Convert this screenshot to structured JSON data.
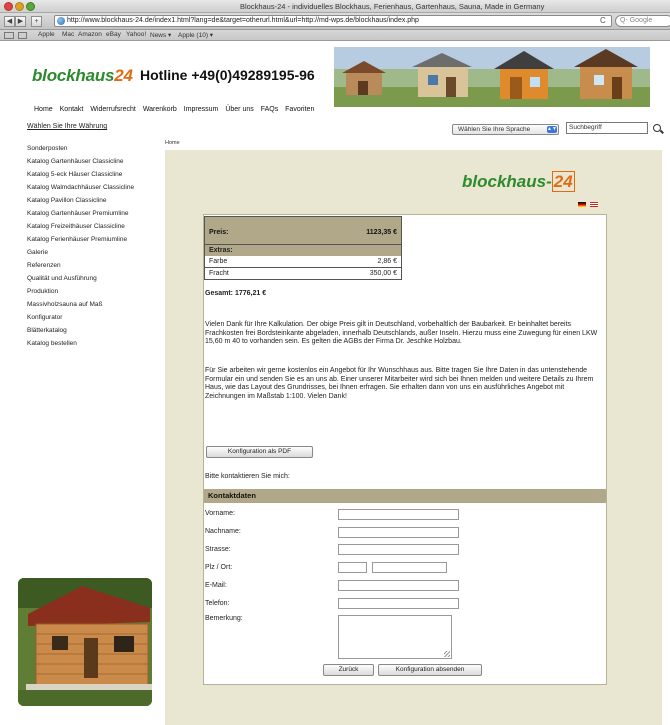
{
  "window": {
    "title": "Blockhaus-24 - individuelles Blockhaus, Ferienhaus, Gartenhaus, Sauna, Made in Germany"
  },
  "browser": {
    "back": "◀",
    "forward": "▶",
    "add": "+",
    "url": "http://www.blockhaus-24.de/index1.html?lang=de&target=otherurl.html&url=http://md-wps.de/blockhaus/index.php",
    "reload": "C",
    "search_placeholder": "Q- Google",
    "bookmarks": [
      "Apple",
      "Mac",
      "Amazon",
      "eBay",
      "Yahoo!",
      "News ▾",
      "Apple (10) ▾"
    ]
  },
  "header": {
    "logo_text": "blockhaus",
    "logo_num": "24",
    "hotline": "Hotline +49(0)49289195-96",
    "nav": [
      "Home",
      "Kontakt",
      "Widerrufsrecht",
      "Warenkorb",
      "Impressum",
      "Über uns",
      "FAQs",
      "Favoriten"
    ]
  },
  "sidebar": {
    "currency_link": "Wählen Sie Ihre Währung",
    "items": [
      "Sonderposten",
      "Katalog Gartenhäuser Classicline",
      "Katalog 5-eck Häuser Classicline",
      "Katalog Walmdachhäuser Classicline",
      "Katalog Pavillon Classicline",
      "Katalog Gartenhäuser Premiumline",
      "Katalog Freizeithäuser Classicline",
      "Katalog Ferienhäuser Premiumline",
      "Galerie",
      "Referenzen",
      "Qualität und Ausführung",
      "Produktion",
      "Massivholzsauna auf Maß",
      "Konfigurator",
      "Blätterkatalog",
      "Katalog bestellen"
    ]
  },
  "language": {
    "selected": "Wählen Sie Ihre Sprache"
  },
  "search": {
    "placeholder": "Suchbegriff"
  },
  "breadcrumb": "Home",
  "brand": {
    "text": "blockhaus-",
    "num": "24"
  },
  "price": {
    "label": "Preis:",
    "value": "1123,35 €",
    "extras_label": "Extras:",
    "extras": [
      {
        "label": "Farbe",
        "value": "2,86 €"
      },
      {
        "label": "Fracht",
        "value": "350,00 €"
      }
    ],
    "total": "Gesamt: 1776,21 €"
  },
  "text": {
    "para1": "Vielen Dank für Ihre Kalkulation. Der obige Preis gilt in Deutschland, vorbehaltlich der Baubarkeit. Er beinhaltet bereits Frachkosten frei Bordsteinkante abgeladen, innerhalb Deutschlands, außer Inseln. Hierzu muss eine Zuwegung für einen LKW 15,60 m 40 to vorhanden sein. Es gelten die AGBs der Firma Dr. Jeschke Holzbau.",
    "para2": "Für Sie arbeiten wir gerne kostenlos ein Angebot für Ihr Wunschhaus aus. Bitte tragen Sie Ihre Daten in das untenstehende Formular ein und senden Sie es an uns ab. Einer unserer Mitarbeiter wird sich bei Ihnen melden und weitere Details zu Ihrem Haus, wie das Layout des Grundrisses, bei Ihnen erfragen. Sie erhalten dann von uns ein ausführliches Angebot mit Zeichnungen im Maßstab 1:100. Vielen Dank!",
    "pdf_button": "Konfiguration als PDF",
    "contact_me": "Bitte kontaktieren Sie mich:"
  },
  "form": {
    "heading": "Kontaktdaten",
    "labels": {
      "vorname": "Vorname:",
      "nachname": "Nachname:",
      "strasse": "Strasse:",
      "plz_ort": "Plz / Ort:",
      "email": "E-Mail:",
      "telefon": "Telefon:",
      "bemerkung": "Bemerkung:"
    },
    "back_button": "Zurück",
    "submit_button": "Konfiguration absenden"
  },
  "colors": {
    "logo_green": "#2d8a2d",
    "logo_orange": "#e06c12",
    "content_bg": "#e9e6d2",
    "table_header": "#b0a888"
  }
}
